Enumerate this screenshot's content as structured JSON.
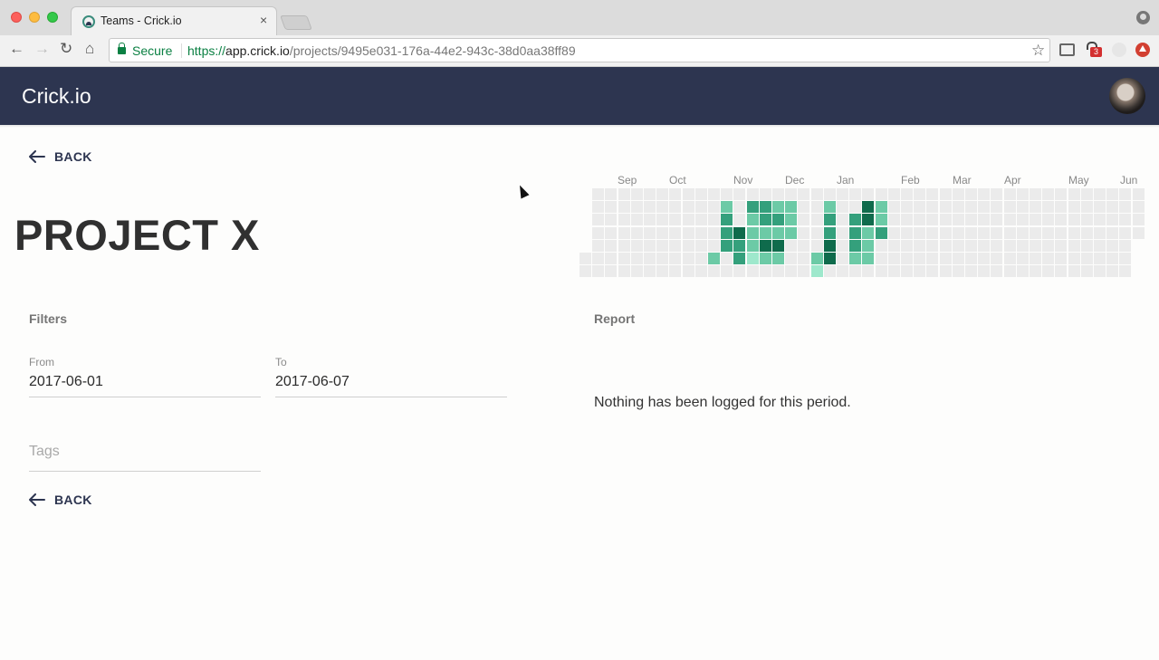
{
  "browser": {
    "tab_title": "Teams - Crick.io",
    "tab_close": "×",
    "secure_label": "Secure",
    "url_scheme": "https://",
    "url_host": "app.crick.io",
    "url_path": "/projects/9495e031-176a-44e2-943c-38d0aa38ff89",
    "extension_badge": "3",
    "nav": {
      "back": "←",
      "forward": "→",
      "reload": "↻",
      "home": "⌂",
      "star": "☆"
    }
  },
  "header": {
    "brand": "Crick.io",
    "avatar": "user-avatar"
  },
  "page": {
    "back_label": "BACK",
    "title": "PROJECT X",
    "filters_label": "Filters",
    "report_label": "Report",
    "from_label": "From",
    "from_value": "2017-06-01",
    "to_label": "To",
    "to_value": "2017-06-07",
    "tags_placeholder": "Tags",
    "empty_message": "Nothing has been logged for this period."
  },
  "chart_data": {
    "type": "heatmap",
    "months": [
      "Sep",
      "Oct",
      "Nov",
      "Dec",
      "Jan",
      "Feb",
      "Mar",
      "Apr",
      "May",
      "Jun"
    ],
    "levels": {
      "colors": [
        "#ebebeb",
        "#9ee8cc",
        "#6ccaa6",
        "#34a07c",
        "#0f6b4c"
      ]
    },
    "weeks": 44,
    "active_cells": [
      {
        "week": 11,
        "day": 1,
        "level": 2
      },
      {
        "week": 11,
        "day": 2,
        "level": 3
      },
      {
        "week": 11,
        "day": 3,
        "level": 3
      },
      {
        "week": 11,
        "day": 4,
        "level": 3
      },
      {
        "week": 12,
        "day": 3,
        "level": 4
      },
      {
        "week": 12,
        "day": 4,
        "level": 3
      },
      {
        "week": 10,
        "day": 5,
        "level": 2
      },
      {
        "week": 12,
        "day": 5,
        "level": 3
      },
      {
        "week": 13,
        "day": 1,
        "level": 3
      },
      {
        "week": 13,
        "day": 2,
        "level": 2
      },
      {
        "week": 13,
        "day": 3,
        "level": 2
      },
      {
        "week": 13,
        "day": 4,
        "level": 2
      },
      {
        "week": 13,
        "day": 5,
        "level": 1
      },
      {
        "week": 14,
        "day": 1,
        "level": 3
      },
      {
        "week": 14,
        "day": 2,
        "level": 3
      },
      {
        "week": 14,
        "day": 3,
        "level": 2
      },
      {
        "week": 14,
        "day": 4,
        "level": 4
      },
      {
        "week": 14,
        "day": 5,
        "level": 2
      },
      {
        "week": 15,
        "day": 1,
        "level": 2
      },
      {
        "week": 15,
        "day": 2,
        "level": 3
      },
      {
        "week": 15,
        "day": 3,
        "level": 2
      },
      {
        "week": 15,
        "day": 4,
        "level": 4
      },
      {
        "week": 15,
        "day": 5,
        "level": 2
      },
      {
        "week": 16,
        "day": 1,
        "level": 2
      },
      {
        "week": 16,
        "day": 2,
        "level": 2
      },
      {
        "week": 16,
        "day": 3,
        "level": 2
      },
      {
        "week": 18,
        "day": 5,
        "level": 2
      },
      {
        "week": 18,
        "day": 6,
        "level": 1
      },
      {
        "week": 19,
        "day": 1,
        "level": 2
      },
      {
        "week": 19,
        "day": 2,
        "level": 3
      },
      {
        "week": 19,
        "day": 3,
        "level": 3
      },
      {
        "week": 19,
        "day": 4,
        "level": 4
      },
      {
        "week": 19,
        "day": 5,
        "level": 4
      },
      {
        "week": 21,
        "day": 2,
        "level": 3
      },
      {
        "week": 21,
        "day": 3,
        "level": 3
      },
      {
        "week": 21,
        "day": 4,
        "level": 3
      },
      {
        "week": 21,
        "day": 5,
        "level": 2
      },
      {
        "week": 22,
        "day": 1,
        "level": 4
      },
      {
        "week": 22,
        "day": 2,
        "level": 4
      },
      {
        "week": 22,
        "day": 3,
        "level": 2
      },
      {
        "week": 22,
        "day": 4,
        "level": 2
      },
      {
        "week": 22,
        "day": 5,
        "level": 2
      },
      {
        "week": 23,
        "day": 1,
        "level": 2
      },
      {
        "week": 23,
        "day": 2,
        "level": 2
      },
      {
        "week": 23,
        "day": 3,
        "level": 3
      }
    ]
  }
}
